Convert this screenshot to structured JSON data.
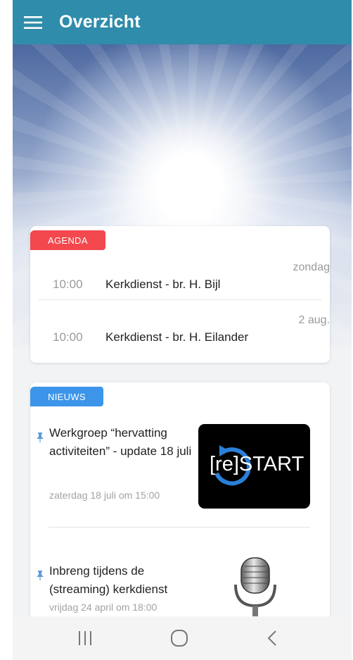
{
  "appbar": {
    "title": "Overzicht",
    "menu_icon": "hamburger-menu-icon",
    "color": "#2f8cab"
  },
  "agenda": {
    "badge": "AGENDA",
    "badge_color": "#f2484e",
    "events": [
      {
        "date": "zondag",
        "time": "10:00",
        "title": "Kerkdienst - br. H. Bijl"
      },
      {
        "date": "2 aug.",
        "time": "10:00",
        "title": "Kerkdienst - br. H. Eilander"
      }
    ]
  },
  "news": {
    "badge": "NIEUWS",
    "badge_color": "#3d95e9",
    "items": [
      {
        "title": "Werkgroep “hervatting activiteiten” - update 18 juli",
        "meta": "zaterdag 18 juli om 15:00",
        "pinned": true,
        "image_text_bracket": "[re]",
        "image_text_word": "START"
      },
      {
        "title": "Inbreng tijdens de (streaming) kerkdienst",
        "meta": "vrijdag 24 april om 18:00",
        "pinned": true,
        "image": "microphone-icon"
      }
    ]
  },
  "navbar": {
    "recent": "recent-apps-icon",
    "home": "home-icon",
    "back": "back-icon"
  }
}
